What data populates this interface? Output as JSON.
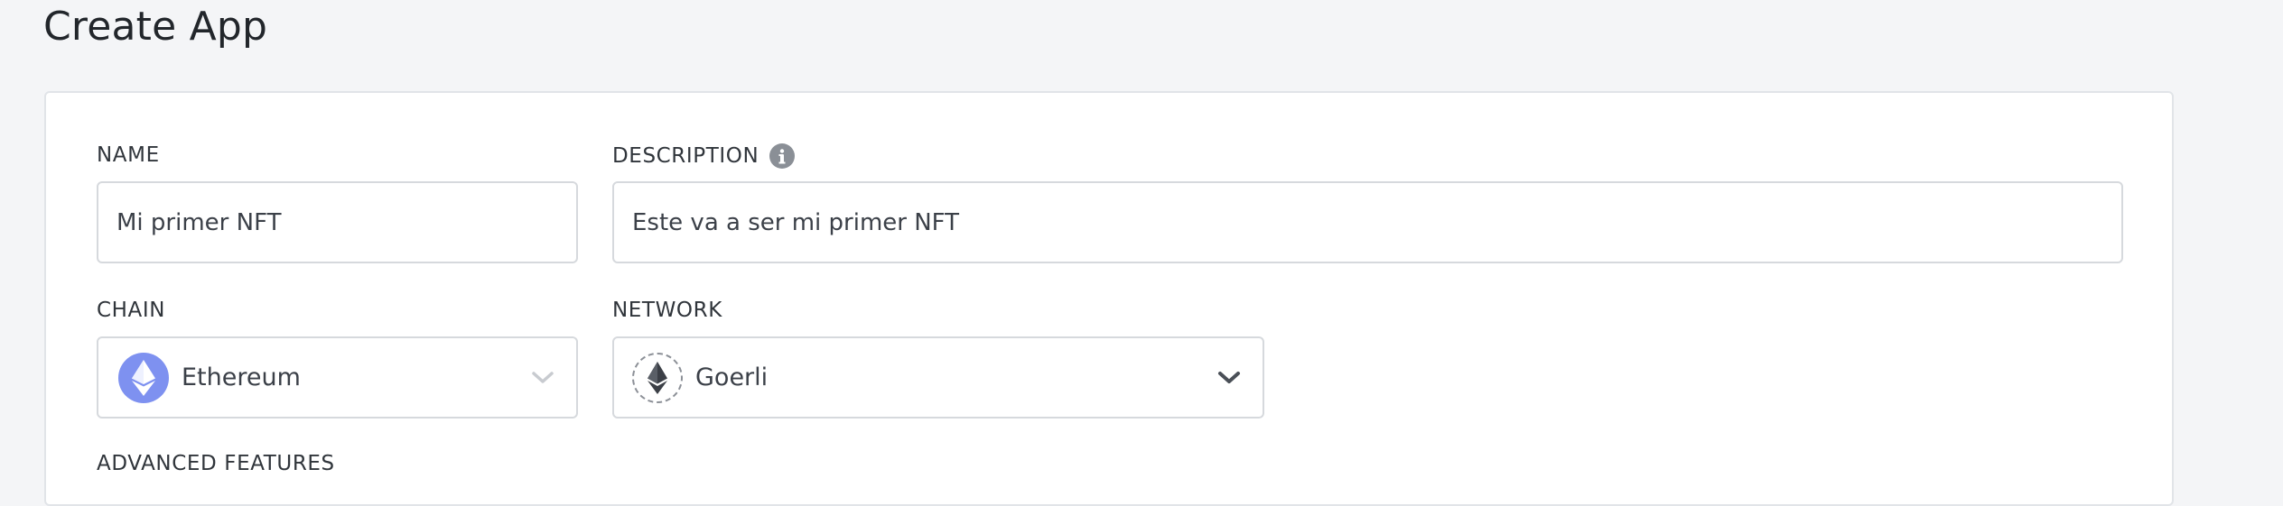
{
  "page": {
    "title": "Create App"
  },
  "form": {
    "name": {
      "label": "NAME",
      "value": "Mi primer NFT"
    },
    "description": {
      "label": "DESCRIPTION",
      "value": "Este va a ser mi primer NFT"
    },
    "chain": {
      "label": "CHAIN",
      "selected": "Ethereum",
      "icon": "ethereum-icon"
    },
    "network": {
      "label": "NETWORK",
      "selected": "Goerli",
      "icon": "ethereum-icon"
    },
    "advanced": {
      "label": "ADVANCED FEATURES"
    }
  },
  "colors": {
    "background": "#f4f5f7",
    "chain_logo": "#7e91f0",
    "border": "#d6d9dd"
  }
}
